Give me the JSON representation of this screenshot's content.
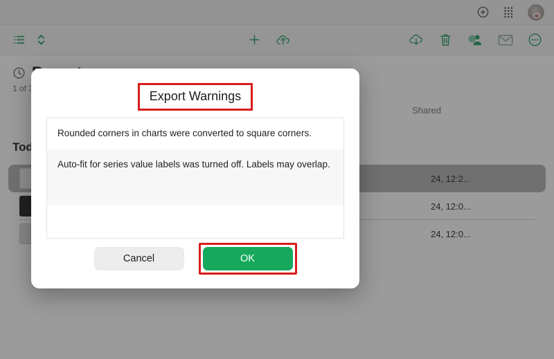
{
  "app": {
    "background_color": "#c3c3c3",
    "accent_green": "#16a85c",
    "annotation_color": "#d81b1b"
  },
  "header": {
    "icons": [
      {
        "name": "add-circle-icon",
        "label": "Add"
      },
      {
        "name": "apps-grid-icon",
        "label": "Apps"
      },
      {
        "name": "avatar",
        "label": "Account"
      }
    ]
  },
  "toolbar": {
    "left": [
      {
        "name": "list-view-icon",
        "label": "List view"
      },
      {
        "name": "sort-icon",
        "label": "Sort"
      }
    ],
    "center": [
      {
        "name": "plus-icon",
        "label": "New"
      },
      {
        "name": "cloud-upload-icon",
        "label": "Upload"
      }
    ],
    "right": [
      {
        "name": "cloud-download-icon",
        "label": "Download"
      },
      {
        "name": "trash-icon",
        "label": "Delete"
      },
      {
        "name": "add-person-icon",
        "label": "Share with person"
      },
      {
        "name": "mail-icon",
        "label": "Email"
      },
      {
        "name": "more-icon",
        "label": "More"
      }
    ]
  },
  "content": {
    "section_title": "Recents",
    "count_label": "1 of 3",
    "group_title": "Today",
    "columns": [
      "Shared"
    ],
    "rows": [
      {
        "name": "",
        "date": "24, 12:2...",
        "selected": true,
        "icon": "doc"
      },
      {
        "name": "",
        "date": "24, 12:0...",
        "selected": false,
        "icon": "black"
      },
      {
        "name": "",
        "date": "24, 12:0...",
        "selected": false,
        "icon": "light"
      }
    ]
  },
  "dialog": {
    "title": "Export Warnings",
    "warnings": [
      "Rounded corners in charts were converted to square corners.",
      "Auto-fit for series value labels was turned off. Labels may overlap."
    ],
    "cancel_label": "Cancel",
    "ok_label": "OK"
  }
}
